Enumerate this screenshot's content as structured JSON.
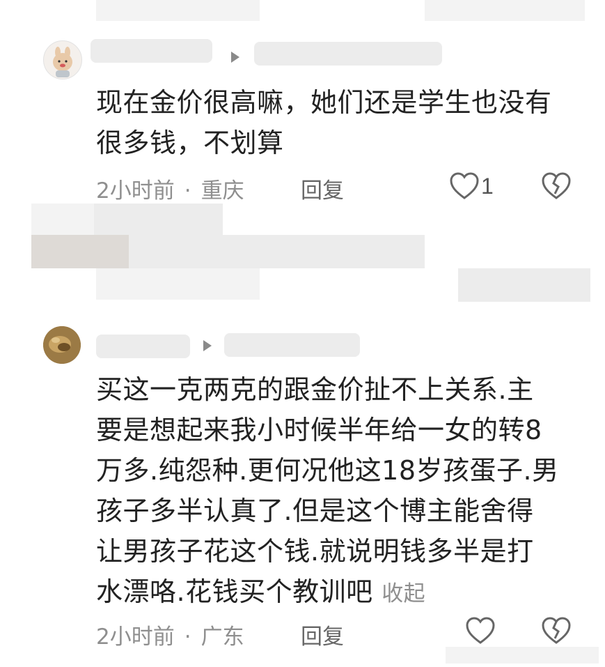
{
  "comments": [
    {
      "text_lines": [
        "现在金价很高嘛，她们还是学生也没有",
        "很多钱，不划算"
      ],
      "time": "2小时前",
      "separator": "·",
      "location": "重庆",
      "reply_label": "回复",
      "like_count": "1"
    },
    {
      "text_lines": [
        "买这一克两克的跟金价扯不上关系.主",
        "要是想起来我小时候半年给一女的转8",
        "万多.纯怨种.更何况他这18岁孩蛋子.男",
        "孩子多半认真了.但是这个博主能舍得",
        "让男孩子花这个钱.就说明钱多半是打",
        "水漂咯.花钱买个教训吧"
      ],
      "collapse_label": "收起",
      "time": "2小时前",
      "separator": "·",
      "location": "广东",
      "reply_label": "回复",
      "like_count": ""
    }
  ],
  "icons": {
    "like": "heart-outline-icon",
    "dislike": "broken-heart-icon",
    "reply_arrow": "triangle-right-icon"
  }
}
